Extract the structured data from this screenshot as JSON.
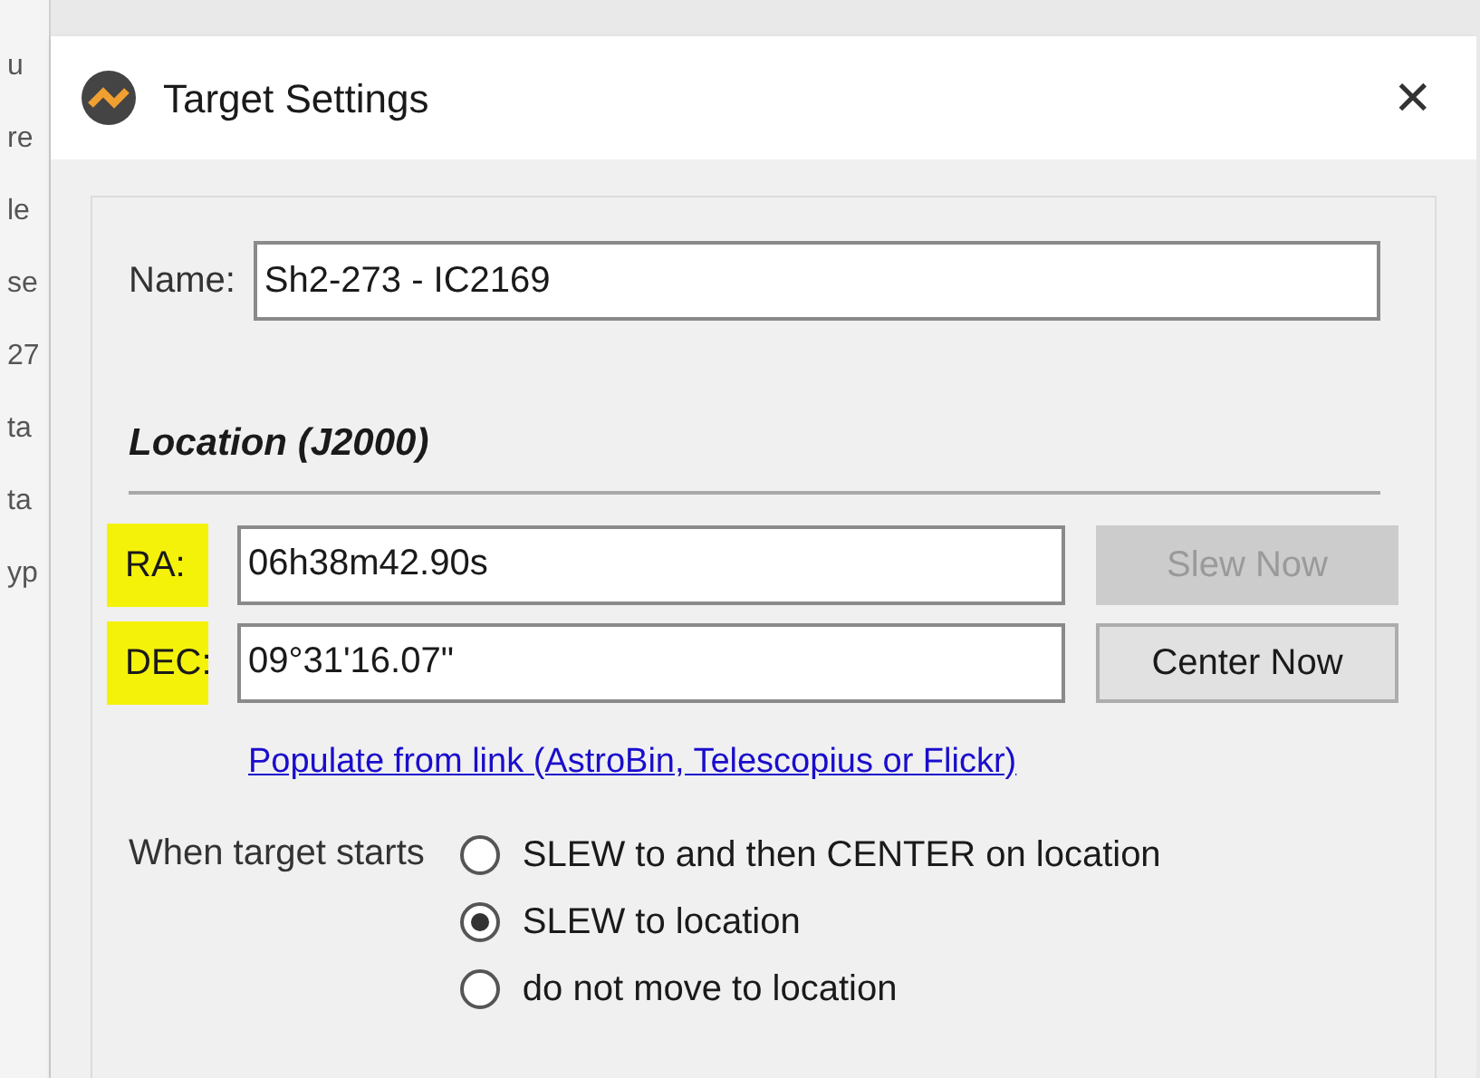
{
  "background_fragments": [
    "u",
    "re",
    "le",
    "se",
    "27",
    "ta",
    "ta",
    "yp"
  ],
  "window": {
    "title": "Target Settings",
    "close": "✕"
  },
  "name_field": {
    "label": "Name:",
    "value": "Sh2-273 - IC2169"
  },
  "location": {
    "heading": "Location (J2000)",
    "rows": [
      {
        "label": "RA:",
        "highlighted": true,
        "value": "06h38m42.90s",
        "button": "Slew Now",
        "disabled": true
      },
      {
        "label": "DEC:",
        "highlighted": true,
        "value": "09°31'16.07\"",
        "button": "Center Now",
        "disabled": false
      }
    ],
    "link": "Populate from link (AstroBin, Telescopius or Flickr)"
  },
  "when_target_starts": {
    "label": "When target starts",
    "options": [
      {
        "label": "SLEW to and then CENTER on location",
        "selected": false
      },
      {
        "label": "SLEW to location",
        "selected": true
      },
      {
        "label": "do not move to location",
        "selected": false
      }
    ]
  }
}
